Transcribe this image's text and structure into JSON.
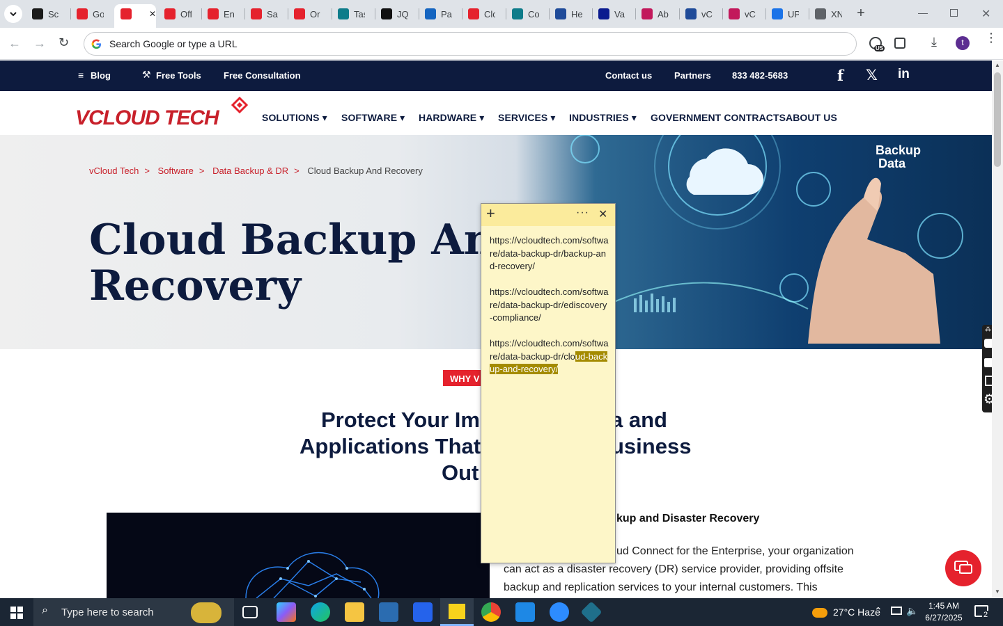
{
  "browser": {
    "tabs": [
      {
        "label": "Scr",
        "fav": "#1a1a1a"
      },
      {
        "label": "Go",
        "fav": "#e5222d"
      },
      {
        "label": "",
        "fav": "#e5222d"
      },
      {
        "label": "Off",
        "fav": "#e5222d"
      },
      {
        "label": "Ent",
        "fav": "#e5222d"
      },
      {
        "label": "Sa",
        "fav": "#e5222d"
      },
      {
        "label": "Or",
        "fav": "#e5222d"
      },
      {
        "label": "Tas",
        "fav": "#0e7c8a"
      },
      {
        "label": "JQ",
        "fav": "#111111"
      },
      {
        "label": "Pa",
        "fav": "#1565c0"
      },
      {
        "label": "Clo",
        "fav": "#e5222d"
      },
      {
        "label": "Co",
        "fav": "#0e7c8a"
      },
      {
        "label": "He",
        "fav": "#1f4b99"
      },
      {
        "label": "Va",
        "fav": "#0b1b8f"
      },
      {
        "label": "Ab",
        "fav": "#c2185b"
      },
      {
        "label": "vCl",
        "fav": "#1f4b99"
      },
      {
        "label": "vCl",
        "fav": "#c2185b"
      },
      {
        "label": "UP",
        "fav": "#1a73e8"
      },
      {
        "label": "XN",
        "fav": "#5f6368"
      }
    ],
    "address": "Search Google or type a URL",
    "profile_initial": "t",
    "badge": "US"
  },
  "site": {
    "top": {
      "blog": "Blog",
      "free_tools": "Free Tools",
      "free_consult": "Free Consultation",
      "contact": "Contact us",
      "partners": "Partners",
      "phone": "833 482-5683"
    },
    "logo": "VCLOUD TECH",
    "nav": [
      "SOLUTIONS",
      "SOFTWARE",
      "HARDWARE",
      "SERVICES",
      "INDUSTRIES",
      "GOVERNMENT CONTRACTS",
      "ABOUT US"
    ],
    "breadcrumb": [
      "vCloud Tech",
      "Software",
      "Data Backup & DR",
      "Cloud Backup And Recovery"
    ],
    "hero_title_1": "Cloud Backup And",
    "hero_title_2": "Recovery",
    "hero_image_text_1": "Backup",
    "hero_image_text_2": "Data",
    "why_badge": "WHY V",
    "protect_1": "Protect Your Im",
    "protect_1b": "a and",
    "protect_2": "Applications That",
    "protect_2b": "usiness",
    "protect_3": "Out",
    "section_title": "kup and Disaster Recovery",
    "para_1": "ud Connect for the Enterprise, your organization",
    "para_2": "can act as a disaster recovery (DR) service provider, providing offsite",
    "para_3": "backup and replication services to your internal customers. This"
  },
  "sticky_note": {
    "links": [
      "https://vcloudtech.com/software/data-backup-dr/backup-and-recovery/",
      "https://vcloudtech.com/software/data-backup-dr/ediscovery-compliance/"
    ],
    "link3_plain": "https://vcloudtech.com/software/data-backup-dr/clo",
    "link3_selected": "ud-backup-and-recovery/"
  },
  "taskbar": {
    "search_placeholder": "Type here to search",
    "weather": "27°C  Haze",
    "time": "1:45 AM",
    "date": "6/27/2025",
    "notif_count": "2"
  }
}
